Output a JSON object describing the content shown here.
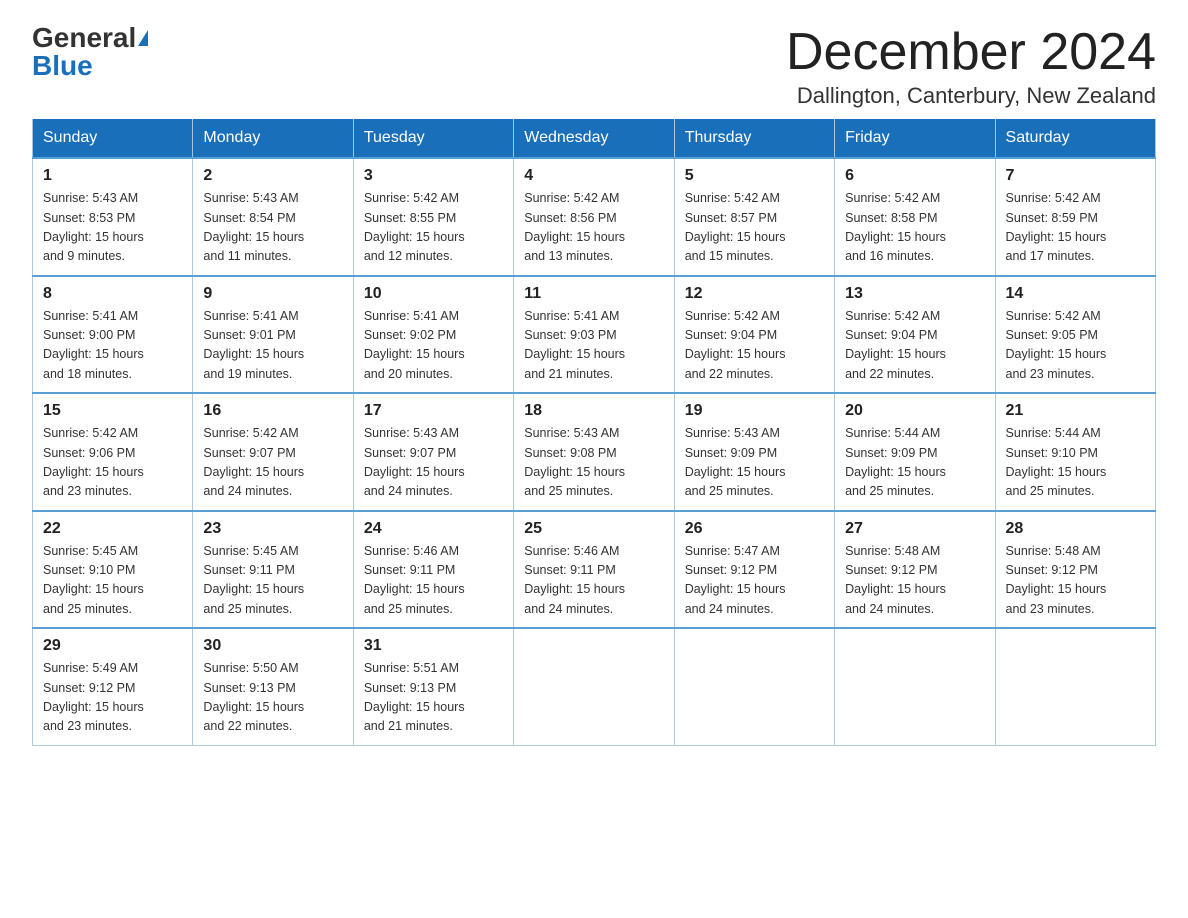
{
  "header": {
    "logo_general": "General",
    "logo_blue": "Blue",
    "month_title": "December 2024",
    "location": "Dallington, Canterbury, New Zealand"
  },
  "weekdays": [
    "Sunday",
    "Monday",
    "Tuesday",
    "Wednesday",
    "Thursday",
    "Friday",
    "Saturday"
  ],
  "weeks": [
    [
      {
        "day": "1",
        "sunrise": "5:43 AM",
        "sunset": "8:53 PM",
        "daylight": "15 hours and 9 minutes."
      },
      {
        "day": "2",
        "sunrise": "5:43 AM",
        "sunset": "8:54 PM",
        "daylight": "15 hours and 11 minutes."
      },
      {
        "day": "3",
        "sunrise": "5:42 AM",
        "sunset": "8:55 PM",
        "daylight": "15 hours and 12 minutes."
      },
      {
        "day": "4",
        "sunrise": "5:42 AM",
        "sunset": "8:56 PM",
        "daylight": "15 hours and 13 minutes."
      },
      {
        "day": "5",
        "sunrise": "5:42 AM",
        "sunset": "8:57 PM",
        "daylight": "15 hours and 15 minutes."
      },
      {
        "day": "6",
        "sunrise": "5:42 AM",
        "sunset": "8:58 PM",
        "daylight": "15 hours and 16 minutes."
      },
      {
        "day": "7",
        "sunrise": "5:42 AM",
        "sunset": "8:59 PM",
        "daylight": "15 hours and 17 minutes."
      }
    ],
    [
      {
        "day": "8",
        "sunrise": "5:41 AM",
        "sunset": "9:00 PM",
        "daylight": "15 hours and 18 minutes."
      },
      {
        "day": "9",
        "sunrise": "5:41 AM",
        "sunset": "9:01 PM",
        "daylight": "15 hours and 19 minutes."
      },
      {
        "day": "10",
        "sunrise": "5:41 AM",
        "sunset": "9:02 PM",
        "daylight": "15 hours and 20 minutes."
      },
      {
        "day": "11",
        "sunrise": "5:41 AM",
        "sunset": "9:03 PM",
        "daylight": "15 hours and 21 minutes."
      },
      {
        "day": "12",
        "sunrise": "5:42 AM",
        "sunset": "9:04 PM",
        "daylight": "15 hours and 22 minutes."
      },
      {
        "day": "13",
        "sunrise": "5:42 AM",
        "sunset": "9:04 PM",
        "daylight": "15 hours and 22 minutes."
      },
      {
        "day": "14",
        "sunrise": "5:42 AM",
        "sunset": "9:05 PM",
        "daylight": "15 hours and 23 minutes."
      }
    ],
    [
      {
        "day": "15",
        "sunrise": "5:42 AM",
        "sunset": "9:06 PM",
        "daylight": "15 hours and 23 minutes."
      },
      {
        "day": "16",
        "sunrise": "5:42 AM",
        "sunset": "9:07 PM",
        "daylight": "15 hours and 24 minutes."
      },
      {
        "day": "17",
        "sunrise": "5:43 AM",
        "sunset": "9:07 PM",
        "daylight": "15 hours and 24 minutes."
      },
      {
        "day": "18",
        "sunrise": "5:43 AM",
        "sunset": "9:08 PM",
        "daylight": "15 hours and 25 minutes."
      },
      {
        "day": "19",
        "sunrise": "5:43 AM",
        "sunset": "9:09 PM",
        "daylight": "15 hours and 25 minutes."
      },
      {
        "day": "20",
        "sunrise": "5:44 AM",
        "sunset": "9:09 PM",
        "daylight": "15 hours and 25 minutes."
      },
      {
        "day": "21",
        "sunrise": "5:44 AM",
        "sunset": "9:10 PM",
        "daylight": "15 hours and 25 minutes."
      }
    ],
    [
      {
        "day": "22",
        "sunrise": "5:45 AM",
        "sunset": "9:10 PM",
        "daylight": "15 hours and 25 minutes."
      },
      {
        "day": "23",
        "sunrise": "5:45 AM",
        "sunset": "9:11 PM",
        "daylight": "15 hours and 25 minutes."
      },
      {
        "day": "24",
        "sunrise": "5:46 AM",
        "sunset": "9:11 PM",
        "daylight": "15 hours and 25 minutes."
      },
      {
        "day": "25",
        "sunrise": "5:46 AM",
        "sunset": "9:11 PM",
        "daylight": "15 hours and 24 minutes."
      },
      {
        "day": "26",
        "sunrise": "5:47 AM",
        "sunset": "9:12 PM",
        "daylight": "15 hours and 24 minutes."
      },
      {
        "day": "27",
        "sunrise": "5:48 AM",
        "sunset": "9:12 PM",
        "daylight": "15 hours and 24 minutes."
      },
      {
        "day": "28",
        "sunrise": "5:48 AM",
        "sunset": "9:12 PM",
        "daylight": "15 hours and 23 minutes."
      }
    ],
    [
      {
        "day": "29",
        "sunrise": "5:49 AM",
        "sunset": "9:12 PM",
        "daylight": "15 hours and 23 minutes."
      },
      {
        "day": "30",
        "sunrise": "5:50 AM",
        "sunset": "9:13 PM",
        "daylight": "15 hours and 22 minutes."
      },
      {
        "day": "31",
        "sunrise": "5:51 AM",
        "sunset": "9:13 PM",
        "daylight": "15 hours and 21 minutes."
      },
      null,
      null,
      null,
      null
    ]
  ]
}
